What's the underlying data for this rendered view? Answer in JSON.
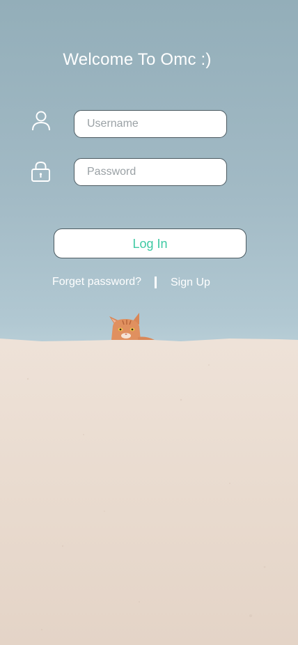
{
  "header": {
    "title": "Welcome To Omc :)"
  },
  "form": {
    "username": {
      "icon": "user-icon",
      "placeholder": "Username",
      "value": ""
    },
    "password": {
      "icon": "lock-icon",
      "placeholder": "Password",
      "value": ""
    },
    "login_label": "Log In"
  },
  "links": {
    "forget_password": "Forget password?",
    "sign_up": "Sign Up"
  },
  "colors": {
    "sky": "#a2bac5",
    "wall": "#eadcd1",
    "accent": "#3ec9a3",
    "border": "#4b5960"
  }
}
